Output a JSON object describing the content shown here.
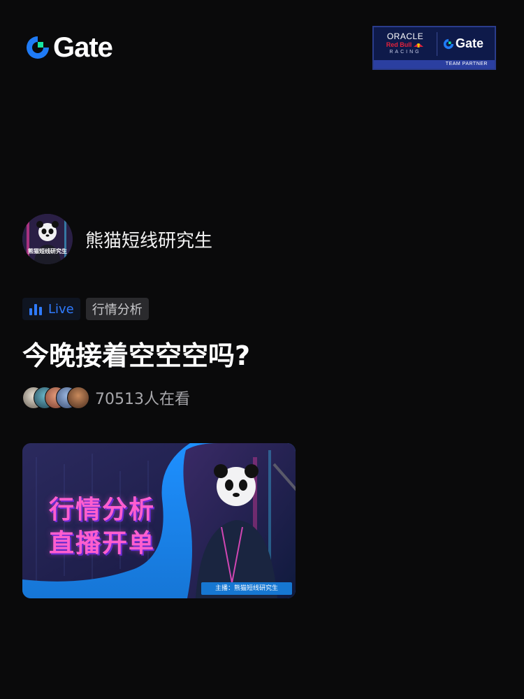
{
  "brand": {
    "logo_text": "Gate",
    "accent_color": "#1f7bf6",
    "green_color": "#17e5a2"
  },
  "partner_badge": {
    "oracle": "ORACLE",
    "red_bull": "Red Bull",
    "racing": "RACING",
    "gate": "Gate",
    "footer": "TEAM PARTNER"
  },
  "host": {
    "name": "熊猫短线研究生",
    "avatar_caption": "熊猫短线研究生"
  },
  "tags": {
    "live": "Live",
    "category": "行情分析"
  },
  "stream": {
    "title": "今晚接着空空空吗?",
    "viewers": "70513人在看"
  },
  "cover": {
    "line1": "行情分析",
    "line2": "直播开单",
    "host_label": "主播：熊猫短线研究生"
  }
}
